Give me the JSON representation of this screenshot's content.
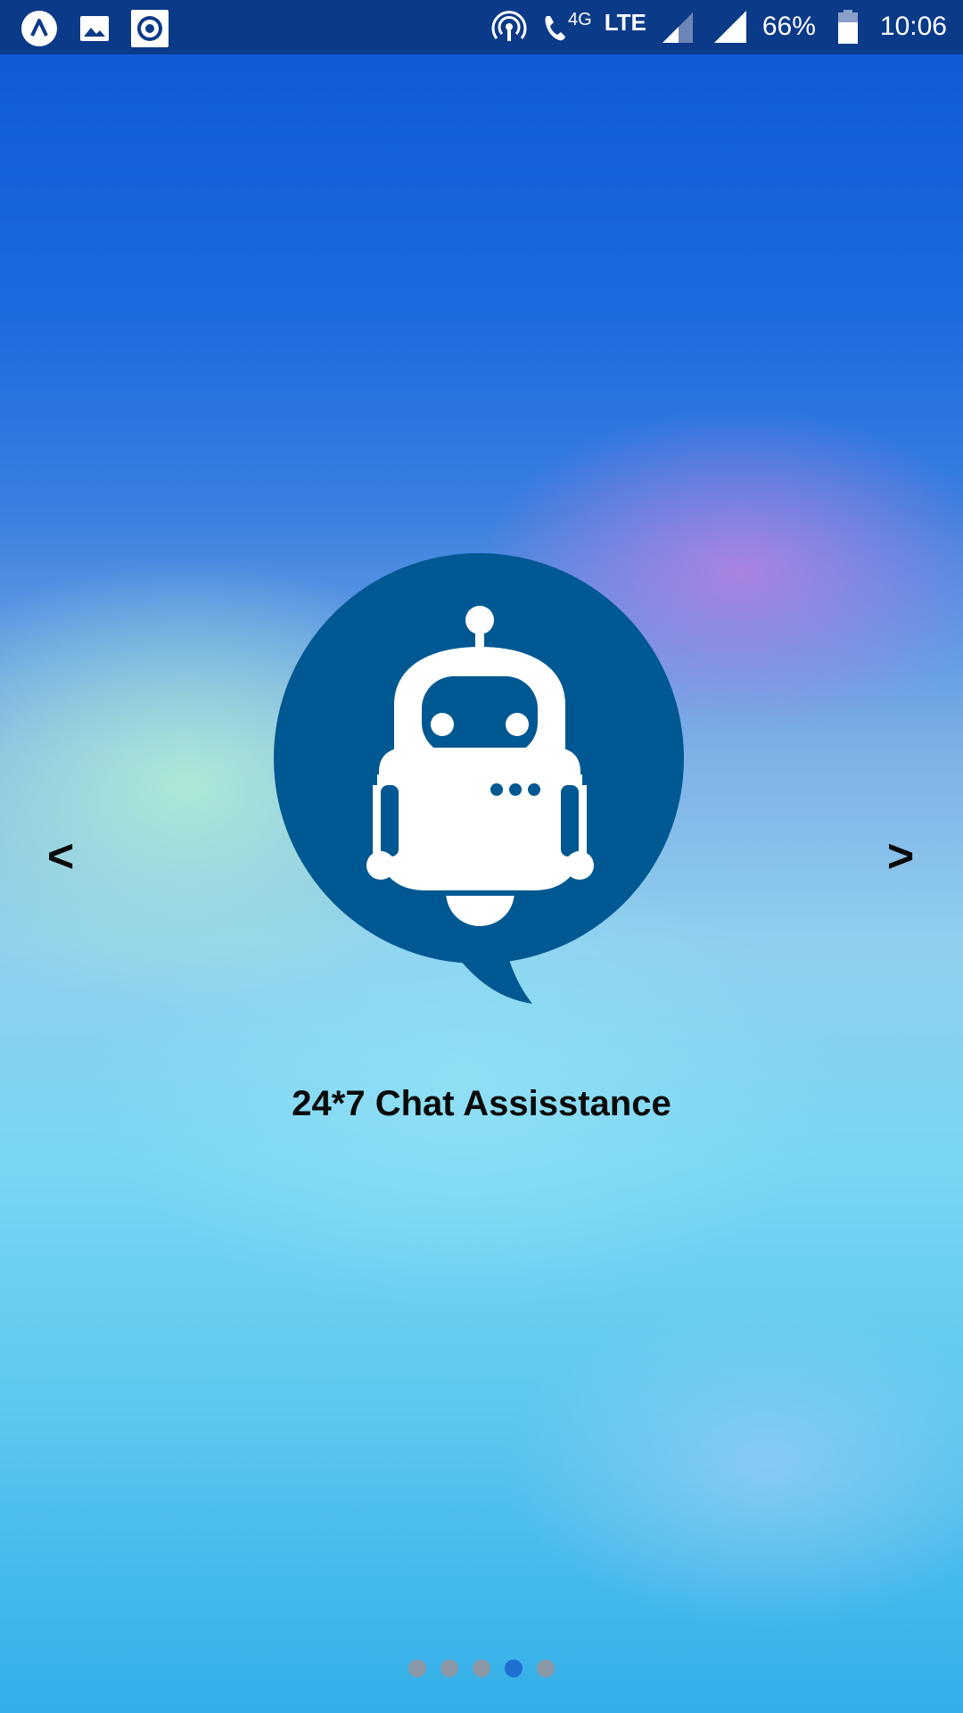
{
  "status_bar": {
    "icons_left": [
      "launcher-icon",
      "gallery-icon",
      "record-icon"
    ],
    "icons_right": [
      "hotspot-icon",
      "volte-call-icon",
      "signal-icon",
      "signal-icon",
      "battery-icon"
    ],
    "network_label": "4G",
    "lte_label": "LTE",
    "battery": "66%",
    "time": "10:06"
  },
  "carousel": {
    "prev_label": "<",
    "next_label": ">",
    "slide_title": "24*7 Chat Assisstance",
    "illustration": "chatbot-robot-icon",
    "dots_total": 5,
    "active_index": 3
  },
  "colors": {
    "status_bar": "#0b3a88",
    "bubble": "#005892",
    "active_dot": "#1f6fd1",
    "inactive_dot": "#8a97a6"
  }
}
